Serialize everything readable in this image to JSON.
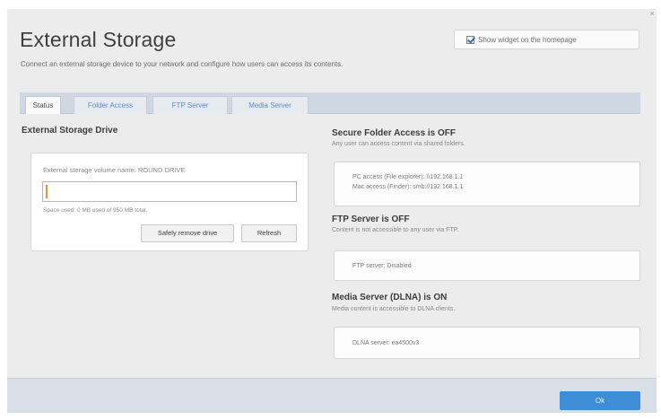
{
  "header": {
    "title": "External Storage",
    "subtitle": "Connect an external storage device to your network and configure how users can access its contents.",
    "close_symbol": "×",
    "widget_toggle": {
      "label": "Show widget on the homepage",
      "checked": true
    }
  },
  "tabs": [
    {
      "label": "Status",
      "active": true
    },
    {
      "label": "Folder Access",
      "active": false
    },
    {
      "label": "FTP Server",
      "active": false
    },
    {
      "label": "Media Server",
      "active": false
    }
  ],
  "drive": {
    "heading": "External Storage Drive",
    "volume_label": "External storage volume name: ROUND DRIVE",
    "volume_value": "",
    "space_used": "Space used: 0 MB used of 950 MB total.",
    "safely_remove_label": "Safely remove drive",
    "refresh_label": "Refresh"
  },
  "secure_folder": {
    "heading": "Secure Folder Access is OFF",
    "subtext": "Any user can access content via shared folders.",
    "pc_access": "PC access (File explorer): \\\\192.168.1.1",
    "mac_access": "Mac access (Finder): smb://192.168.1.1"
  },
  "ftp": {
    "heading": "FTP Server is OFF",
    "subtext": "Content is not accessible to any user via FTP.",
    "status": "FTP server: Disabled"
  },
  "media": {
    "heading": "Media Server (DLNA) is ON",
    "subtext": "Media content is accessible to DLNA clients.",
    "status": "DLNA server: ea4500v3"
  },
  "footer": {
    "ok_label": "Ok"
  },
  "colors": {
    "accent": "#3d8ed6",
    "tab_link": "#5d8bbf",
    "tab_bar": "#cfd8e2"
  }
}
